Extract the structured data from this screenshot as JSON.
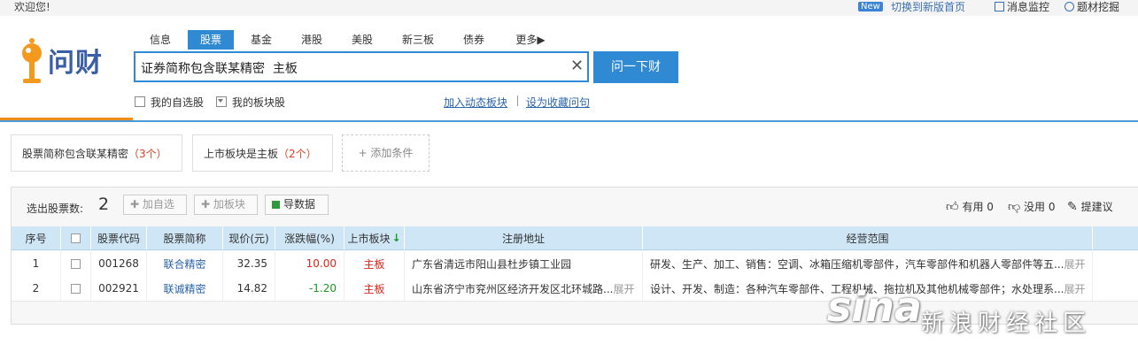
{
  "topbar": {
    "welcome": "欢迎您!",
    "new_badge": "New",
    "switch_link": "切换到新版首页",
    "msg_monitor": "消息监控",
    "mining": "题材挖掘"
  },
  "logo": {
    "text": "问财"
  },
  "tabs": [
    {
      "label": "信息"
    },
    {
      "label": "股票"
    },
    {
      "label": "基金"
    },
    {
      "label": "港股"
    },
    {
      "label": "美股"
    },
    {
      "label": "新三板"
    },
    {
      "label": "债券"
    },
    {
      "label": "更多▶"
    }
  ],
  "search": {
    "value": "证券简称包含联某精密  主板",
    "button": "问一下财"
  },
  "options": {
    "my_watchlist": "我的自选股",
    "my_sectors": "我的板块股",
    "add_dynamic": "加入动态板块",
    "set_favorite": "设为收藏问句"
  },
  "conditions": [
    {
      "label": "股票简称包含联某精密",
      "count": "（3个）"
    },
    {
      "label": "上市板块是主板",
      "count": "（2个）"
    }
  ],
  "add_condition": "+  添加条件",
  "results": {
    "count_label": "选出股票数:",
    "count": "2",
    "btn_add_watch": "✚ 加自选",
    "btn_add_sector": "✚ 加板块",
    "btn_export": "导数据",
    "useful": "有用 0",
    "useless": "没用 0",
    "suggest": "提建议"
  },
  "table": {
    "headers": [
      "序号",
      "",
      "股票代码",
      "股票简称",
      "现价(元)",
      "涨跌幅(%)",
      "上市板块",
      "注册地址",
      "经营范围"
    ],
    "expand": "展开",
    "rows": [
      {
        "idx": "1",
        "code": "001268",
        "name": "联合精密",
        "price": "32.35",
        "change": "10.00",
        "board": "主板",
        "address": "广东省清远市阳山县杜步镇工业园",
        "scope": "研发、生产、加工、销售：空调、冰箱压缩机零部件，汽车零部件和机器人零部件等五..."
      },
      {
        "idx": "2",
        "code": "002921",
        "name": "联诚精密",
        "price": "14.82",
        "change": "-1.20",
        "board": "主板",
        "address": "山东省济宁市兖州区经济开发区北环城路...",
        "scope": "设计、开发、制造：各种汽车零部件、工程机械、拖拉机及其他机械零部件；水处理系..."
      }
    ]
  },
  "watermark": {
    "logo": "sina",
    "text": "新浪财经社区"
  }
}
